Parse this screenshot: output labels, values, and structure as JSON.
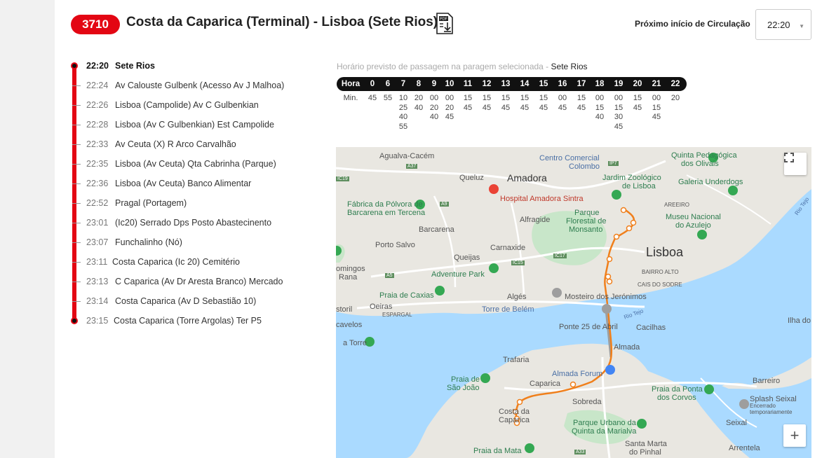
{
  "route": {
    "number": "3710",
    "title": "Costa da Caparica (Terminal) - Lisboa (Sete Rios)"
  },
  "next_start": {
    "label": "Próximo início de Circulação",
    "value": "22:20"
  },
  "stops": [
    {
      "time": "22:20",
      "name": "Sete Rios"
    },
    {
      "time": "22:24",
      "name": "Av Calouste Gulbenk (Acesso Av J Malhoa)"
    },
    {
      "time": "22:26",
      "name": "Lisboa (Campolide) Av C Gulbenkian"
    },
    {
      "time": "22:28",
      "name": "Lisboa (Av C Gulbenkian) Est Campolide"
    },
    {
      "time": "22:33",
      "name": "Av Ceuta (X) R Arco Carvalhão"
    },
    {
      "time": "22:35",
      "name": "Lisboa (Av Ceuta) Qta Cabrinha (Parque)"
    },
    {
      "time": "22:36",
      "name": "Lisboa (Av Ceuta) Banco Alimentar"
    },
    {
      "time": "22:52",
      "name": "Pragal (Portagem)"
    },
    {
      "time": "23:01",
      "name": "(Ic20) Serrado Dps Posto Abastecinento"
    },
    {
      "time": "23:07",
      "name": "Funchalinho (Nó)"
    },
    {
      "time": "23:11",
      "name": "Costa Caparica (Ic 20) Cemitério"
    },
    {
      "time": "23:13",
      "name": "C Caparica (Av Dr Aresta Branco) Mercado"
    },
    {
      "time": "23:14",
      "name": "Costa Caparica (Av D Sebastião 10)"
    },
    {
      "time": "23:15",
      "name": "Costa Caparica (Torre Argolas) Ter P5"
    }
  ],
  "schedule": {
    "caption": "Horário previsto de passagem na paragem selecionada - ",
    "caption_stop": "Sete Rios",
    "hour_label": "Hora",
    "min_label": "Min.",
    "hours": [
      "0",
      "6",
      "7",
      "8",
      "9",
      "10",
      "11",
      "12",
      "13",
      "14",
      "15",
      "16",
      "17",
      "18",
      "19",
      "20",
      "21",
      "22"
    ],
    "minutes": [
      [
        "45"
      ],
      [
        "55"
      ],
      [
        "10",
        "25",
        "40",
        "55"
      ],
      [
        "20",
        "40"
      ],
      [
        "00",
        "20",
        "40"
      ],
      [
        "00",
        "20",
        "45"
      ],
      [
        "15",
        "45"
      ],
      [
        "15",
        "45"
      ],
      [
        "15",
        "45"
      ],
      [
        "15",
        "45"
      ],
      [
        "15",
        "45"
      ],
      [
        "00",
        "45"
      ],
      [
        "15",
        "45"
      ],
      [
        "00",
        "15",
        "40"
      ],
      [
        "00",
        "15",
        "30",
        "45"
      ],
      [
        "15",
        "45"
      ],
      [
        "00",
        "15",
        "45"
      ],
      [
        "20"
      ]
    ]
  },
  "map": {
    "labels": {
      "agualva": "Agualva-Cacém",
      "amadora": "Amadora",
      "queluz": "Queluz",
      "centro_comercial": "Centro Comercial",
      "colombo": "Colombo",
      "quinta_pedagogica": "Quinta Pedagógica",
      "dos_olivais": "dos Olivais",
      "jardim_zoologico": "Jardim Zoológico",
      "de_lisboa": "de Lisboa",
      "galeria_underdogs": "Galeria Underdogs",
      "fabrica_polvora": "Fábrica da Pólvora de",
      "barcarena_tercena": "Barcarena em Tercena",
      "hospital": "Hospital Amadora Sintra",
      "alfragide": "Alfragide",
      "parque_florestal": "Parque",
      "florestal_de": "Florestal de",
      "monsanto": "Monsanto",
      "museu_azulejo": "Museu Nacional",
      "do_azulejo": "do Azulejo",
      "barcarena": "Barcarena",
      "porto_salvo": "Porto Salvo",
      "carnaxide": "Carnaxide",
      "lisboa": "Lisboa",
      "queijas": "Queijas",
      "adventure_park": "Adventure Park",
      "bairro_alto": "BAIRRO ALTO",
      "cais_sodre": "CAIS DO SODRE",
      "praia_caxias": "Praia de Caxias",
      "oeiras": "Oeiras",
      "alges": "Algés",
      "torre_belem": "Torre de Belém",
      "mosteiro": "Mosteiro dos Jerónimos",
      "espargal": "ESPARGAL",
      "ponte_25": "Ponte 25 de Abril",
      "cacilhas": "Cacilhas",
      "ilha_do": "Ilha do",
      "cavelos": "cavelos",
      "a_torre": "a Torre",
      "almada": "Almada",
      "trafaria": "Trafaria",
      "almada_forum": "Almada Forum",
      "barreiro": "Barreiro",
      "praia_sao_joao": "Praia de",
      "sao_joao": "São João",
      "caparica": "Caparica",
      "praia_ponta": "Praia da Ponta",
      "dos_corvos": "dos Corvos",
      "sobreda": "Sobreda",
      "splash_seixal": "Splash Seixal",
      "encerrado": "Encerrado",
      "temporariamente": "temporariamente",
      "costa_da": "Costa da",
      "caparica2": "Caparica",
      "parque_urbano": "Parque Urbano da",
      "quinta_marialva": "Quinta da Marialva",
      "seixal": "Seixal",
      "santa_marta": "Santa Marta",
      "do_pinhal": "do Pinhal",
      "arrentela": "Arrentela",
      "praia_mata": "Praia da Mata",
      "rio_tejo": "Rio Tejo",
      "rio_tejo2": "Rio Tejo",
      "areeiro": "AREEIRO",
      "omingos": "omingos",
      "rana": "Rana",
      "storil": "storil",
      "a37": "A37",
      "a9": "A9",
      "a5": "A5",
      "ic15": "IC15",
      "ic17": "IC17",
      "a33": "A33",
      "ip7": "IP7",
      "ic19": "IC19"
    },
    "zoom_in": "+",
    "route_color": "#f07f1b",
    "water_color": "#aadaff",
    "green_color": "#c8e6c9"
  }
}
